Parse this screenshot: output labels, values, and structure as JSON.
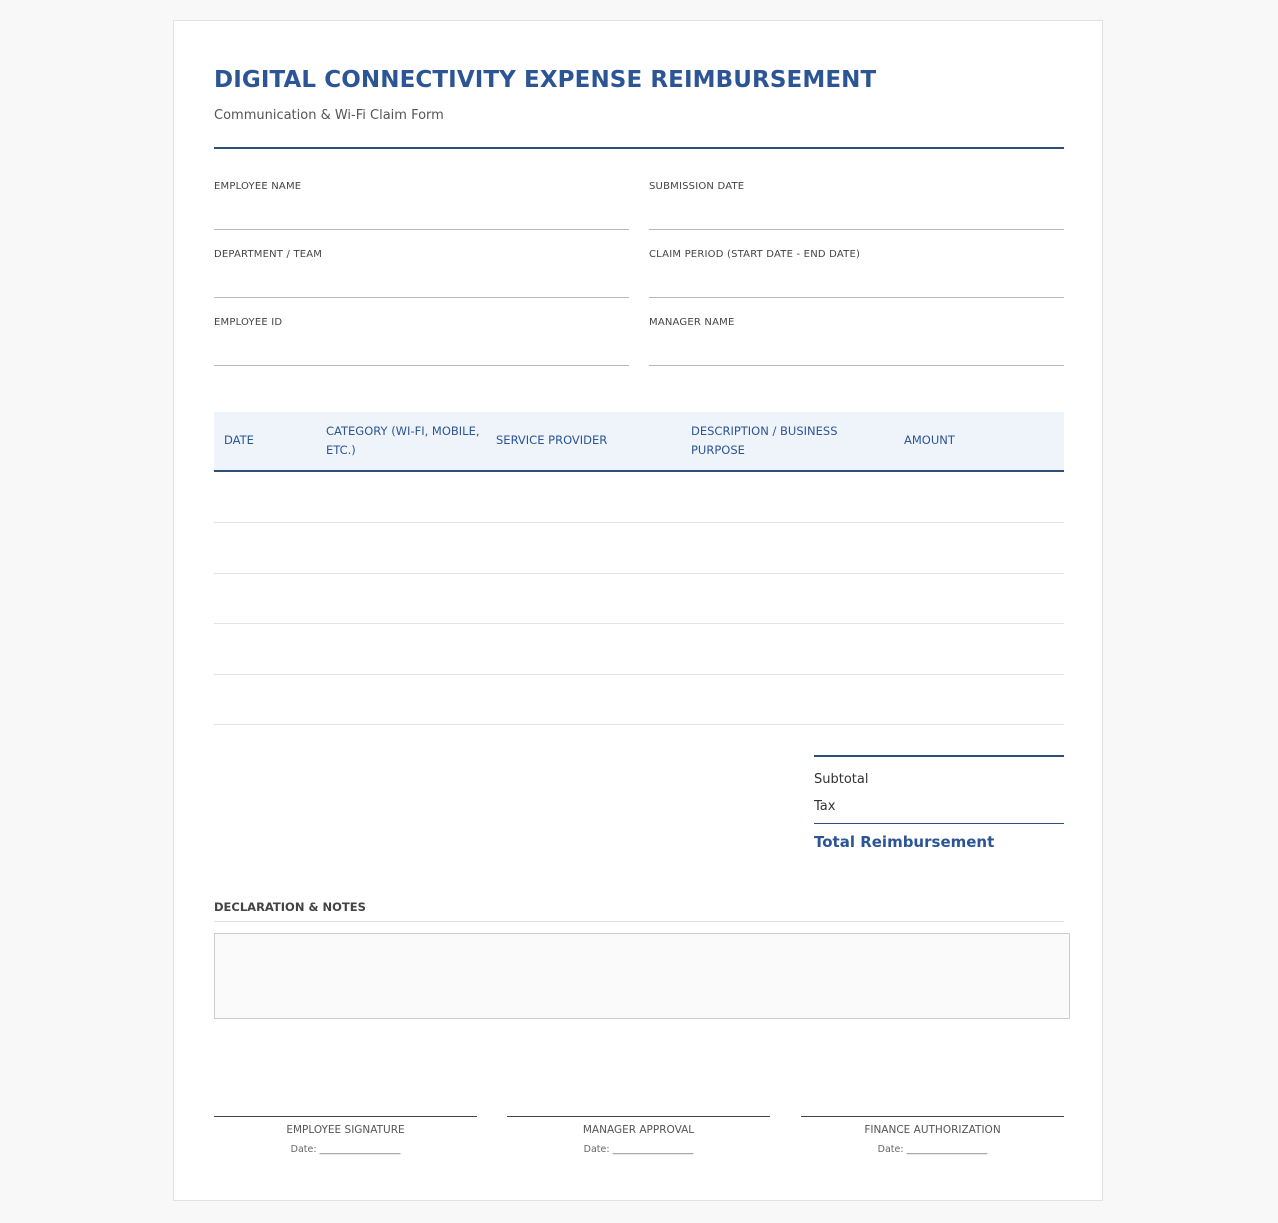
{
  "header": {
    "title": "DIGITAL CONNECTIVITY EXPENSE REIMBURSEMENT",
    "subtitle": "Communication & Wi-Fi Claim Form"
  },
  "fields": {
    "employee_name": "EMPLOYEE NAME",
    "submission_date": "SUBMISSION DATE",
    "department": "DEPARTMENT / TEAM",
    "claim_period": "CLAIM PERIOD (START DATE - END DATE)",
    "employee_id": "EMPLOYEE ID",
    "manager_name": "MANAGER NAME"
  },
  "table": {
    "columns": [
      "DATE",
      "CATEGORY (WI-FI, MOBILE, ETC.)",
      "SERVICE PROVIDER",
      "DESCRIPTION / BUSINESS PURPOSE",
      "AMOUNT"
    ]
  },
  "totals": {
    "subtotal": "Subtotal",
    "tax": "Tax",
    "total": "Total Reimbursement"
  },
  "declaration": {
    "title": "DECLARATION & NOTES"
  },
  "signatures": {
    "employee": "EMPLOYEE SIGNATURE",
    "manager": "MANAGER APPROVAL",
    "finance": "FINANCE AUTHORIZATION",
    "date_line": "Date: _________________"
  },
  "colors": {
    "accent": "#2c5596",
    "rule": "#2e4f78",
    "table_header_bg": "#eff4fa"
  }
}
